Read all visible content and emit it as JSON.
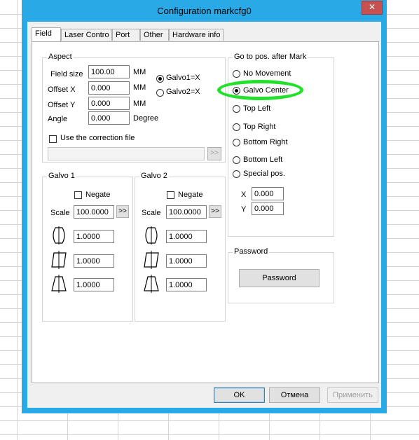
{
  "window": {
    "title": "Configuration markcfg0",
    "close_glyph": "✕"
  },
  "tabs": [
    {
      "label": "Field",
      "active": true
    },
    {
      "label": "Laser Contro",
      "active": false
    },
    {
      "label": "Port",
      "active": false
    },
    {
      "label": "Other",
      "active": false
    },
    {
      "label": "Hardware info",
      "active": false
    }
  ],
  "aspect": {
    "title": "Aspect",
    "field_size": {
      "label": "Field size",
      "value": "100.00",
      "unit": "MM"
    },
    "offset_x": {
      "label": "Offset X",
      "value": "0.000",
      "unit": "MM"
    },
    "offset_y": {
      "label": "Offset Y",
      "value": "0.000",
      "unit": "MM"
    },
    "angle": {
      "label": "Angle",
      "value": "0.000",
      "unit": "Degree"
    },
    "galvo1x": {
      "label": "Galvo1=X",
      "checked": true
    },
    "galvo2x": {
      "label": "Galvo2=X",
      "checked": false
    },
    "correction": {
      "label": "Use the correction file",
      "checked": false,
      "path": "",
      "browse": ">>"
    }
  },
  "goto": {
    "title": "Go to pos. after Mark",
    "options": [
      {
        "label": "No Movement",
        "checked": false
      },
      {
        "label": "Galvo Center",
        "checked": true
      },
      {
        "label": "Top Left",
        "checked": false
      },
      {
        "label": "Top Right",
        "checked": false
      },
      {
        "label": "Bottom Right",
        "checked": false
      },
      {
        "label": "Bottom Left",
        "checked": false
      },
      {
        "label": "Special pos.",
        "checked": false
      }
    ],
    "x": {
      "label": "X",
      "value": "0.000"
    },
    "y": {
      "label": "Y",
      "value": "0.000"
    }
  },
  "galvo1": {
    "title": "Galvo 1",
    "negate": {
      "label": "Negate",
      "checked": false
    },
    "scale": {
      "label": "Scale",
      "value": "100.0000",
      "button": ">>"
    },
    "barrel": "1.0000",
    "parallelogram": "1.0000",
    "trapezoid": "1.0000"
  },
  "galvo2": {
    "title": "Galvo 2",
    "negate": {
      "label": "Negate",
      "checked": false
    },
    "scale": {
      "label": "Scale",
      "value": "100.0000",
      "button": ">>"
    },
    "barrel": "1.0000",
    "parallelogram": "1.0000",
    "trapezoid": "1.0000"
  },
  "password": {
    "title": "Password",
    "button": "Password"
  },
  "footer": {
    "ok": "OK",
    "cancel": "Отмена",
    "apply": "Применить"
  },
  "colors": {
    "titlebar": "#29a9e6",
    "highlight": "#22e02c",
    "close": "#c75050"
  }
}
